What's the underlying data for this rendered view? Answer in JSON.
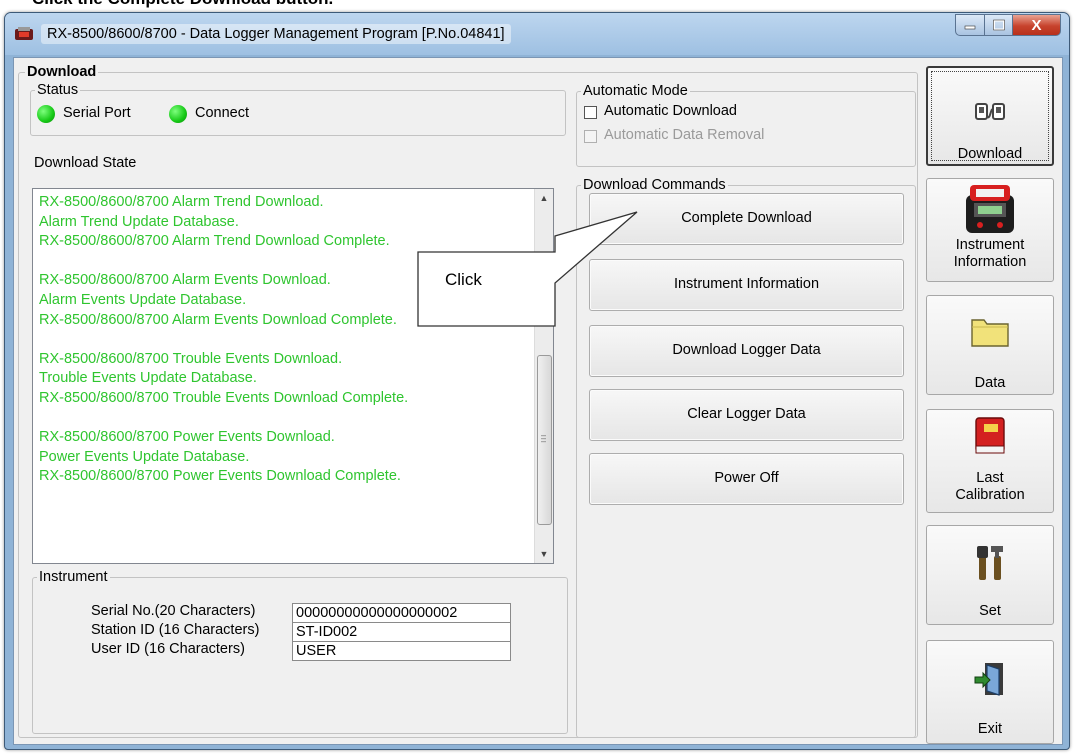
{
  "caption": "Click the Complete Download button.",
  "window": {
    "title": "RX-8500/8600/8700 - Data Logger Management Program [P.No.04841]",
    "controls": {
      "minimize": "–",
      "maximize": "□",
      "close": "X"
    }
  },
  "download": {
    "group_label": "Download",
    "status": {
      "label": "Status",
      "indicators": [
        {
          "label": "Serial Port",
          "color": "#16c916"
        },
        {
          "label": "Connect",
          "color": "#16c916"
        }
      ]
    },
    "state_label": "Download State",
    "log_color": "#2fc52f",
    "log_lines": [
      "RX-8500/8600/8700 Alarm Trend Download.",
      "Alarm Trend Update Database.",
      "RX-8500/8600/8700 Alarm Trend Download Complete.",
      "",
      "RX-8500/8600/8700 Alarm Events Download.",
      "Alarm Events Update Database.",
      "RX-8500/8600/8700 Alarm Events Download Complete.",
      "",
      "RX-8500/8600/8700 Trouble Events Download.",
      "Trouble Events Update Database.",
      "RX-8500/8600/8700 Trouble Events Download Complete.",
      "",
      "RX-8500/8600/8700 Power Events Download.",
      "Power Events Update Database.",
      "RX-8500/8600/8700 Power Events Download Complete."
    ],
    "automatic_mode": {
      "label": "Automatic Mode",
      "automatic_download": {
        "label": "Automatic Download",
        "checked": false,
        "enabled": true
      },
      "automatic_data_removal": {
        "label": "Automatic Data Removal",
        "checked": false,
        "enabled": false
      }
    },
    "commands": {
      "label": "Download Commands",
      "buttons": [
        "Complete Download",
        "Instrument Information",
        "Download Logger Data",
        "Clear Logger Data",
        "Power Off"
      ]
    },
    "instrument": {
      "label": "Instrument",
      "serial_label": "Serial No.(20 Characters)",
      "serial_value": "00000000000000000002",
      "station_label": "Station ID (16 Characters)",
      "station_value": "ST-ID002",
      "user_label": "User ID (16 Characters)",
      "user_value": "USER"
    }
  },
  "callout": {
    "text": "Click"
  },
  "nav": [
    {
      "label": "Download",
      "icon": "download-icon",
      "active": true
    },
    {
      "label": "Instrument Information",
      "icon": "instrument-icon",
      "active": false
    },
    {
      "label": "Data",
      "icon": "folder-icon",
      "active": false
    },
    {
      "label": "Last Calibration",
      "icon": "calibration-book-icon",
      "active": false
    },
    {
      "label": "Set",
      "icon": "tools-icon",
      "active": false
    },
    {
      "label": "Exit",
      "icon": "exit-door-icon",
      "active": false
    }
  ]
}
